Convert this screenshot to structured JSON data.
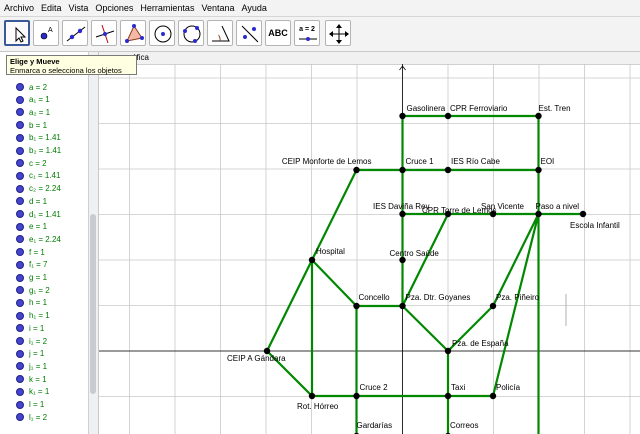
{
  "menu": [
    "Archivo",
    "Edita",
    "Vista",
    "Opciones",
    "Herramientas",
    "Ventana",
    "Ayuda"
  ],
  "toolbar": {
    "tools": [
      {
        "name": "move-tool-icon"
      },
      {
        "name": "new-point-tool-icon"
      },
      {
        "name": "line-tool-icon"
      },
      {
        "name": "perpendicular-line-tool-icon"
      },
      {
        "name": "polygon-tool-icon"
      },
      {
        "name": "circle-center-point-tool-icon"
      },
      {
        "name": "circle-three-points-tool-icon"
      },
      {
        "name": "angle-tool-icon"
      },
      {
        "name": "reflect-tool-icon"
      },
      {
        "name": "text-tool-icon",
        "text": "ABC"
      },
      {
        "name": "slider-tool-icon",
        "text": "a = 2"
      },
      {
        "name": "move-graphics-view-tool-icon"
      }
    ]
  },
  "tooltip": {
    "title": "Elige y Mueve",
    "description": "Enmarca o selecciona los objetos"
  },
  "graphics_header": "áfica",
  "algebra": [
    {
      "label": "a = 2"
    },
    {
      "label": "a₁ = 1"
    },
    {
      "label": "a₂ = 1"
    },
    {
      "label": "b = 1"
    },
    {
      "label": "b₁ = 1.41"
    },
    {
      "label": "b₂ = 1.41"
    },
    {
      "label": "c = 2"
    },
    {
      "label": "c₁ = 1.41"
    },
    {
      "label": "c₂ = 2.24"
    },
    {
      "label": "d = 1"
    },
    {
      "label": "d₁ = 1.41"
    },
    {
      "label": "e = 1"
    },
    {
      "label": "e₁ = 2.24"
    },
    {
      "label": "f = 1"
    },
    {
      "label": "f₁ = 7"
    },
    {
      "label": "g = 1"
    },
    {
      "label": "g₁ = 2"
    },
    {
      "label": "h = 1"
    },
    {
      "label": "h₁ = 1"
    },
    {
      "label": "i = 1"
    },
    {
      "label": "i₁ = 2"
    },
    {
      "label": "j = 1"
    },
    {
      "label": "j₁ = 1"
    },
    {
      "label": "k = 1"
    },
    {
      "label": "k₁ = 1"
    },
    {
      "label": "l = 1"
    },
    {
      "label": "l₁ = 2"
    }
  ],
  "points": [
    {
      "id": "gasolinera",
      "label": "Gasolinera"
    },
    {
      "id": "cpr_ferroviario",
      "label": "CPR Ferroviario"
    },
    {
      "id": "est_tren",
      "label": "Est. Tren"
    },
    {
      "id": "ceip_monforte",
      "label": "CEIP Monforte de Lemos"
    },
    {
      "id": "cruce1",
      "label": "Cruce 1"
    },
    {
      "id": "ies_rio_cabe",
      "label": "IES Río Cabe"
    },
    {
      "id": "eoi",
      "label": "EOI"
    },
    {
      "id": "ies_davina",
      "label": "IES Daviña Rey"
    },
    {
      "id": "cpr_torre",
      "label": "CPR Torre de Lemos"
    },
    {
      "id": "san_vicente",
      "label": "San Vicente"
    },
    {
      "id": "paso_nivel",
      "label": "Paso a nivel"
    },
    {
      "id": "escola_infantil",
      "label": "Escola Infantil"
    },
    {
      "id": "hospital",
      "label": "Hospital"
    },
    {
      "id": "centro_saude",
      "label": "Centro Saúde"
    },
    {
      "id": "concello",
      "label": "Concello"
    },
    {
      "id": "pza_goyanes",
      "label": "Pza. Dtr. Goyanes"
    },
    {
      "id": "pza_pineiro",
      "label": "Pza. Piñeiro"
    },
    {
      "id": "ceip_gandara",
      "label": "CEIP A Gándara"
    },
    {
      "id": "pza_espana",
      "label": "Pza. de España"
    },
    {
      "id": "cruce2",
      "label": "Cruce 2"
    },
    {
      "id": "taxi",
      "label": "Taxi"
    },
    {
      "id": "policia",
      "label": "Policía"
    },
    {
      "id": "rot_horreo",
      "label": "Rot. Hórreo"
    },
    {
      "id": "gardarias",
      "label": "Gardarías"
    },
    {
      "id": "correos",
      "label": "Correos"
    }
  ],
  "colors": {
    "segment": "#008800",
    "point": "#000000",
    "grid": "#c8c8c8",
    "axis": "#000000",
    "algebra_text": "#007c00",
    "algebra_dot": "#4444cc"
  }
}
